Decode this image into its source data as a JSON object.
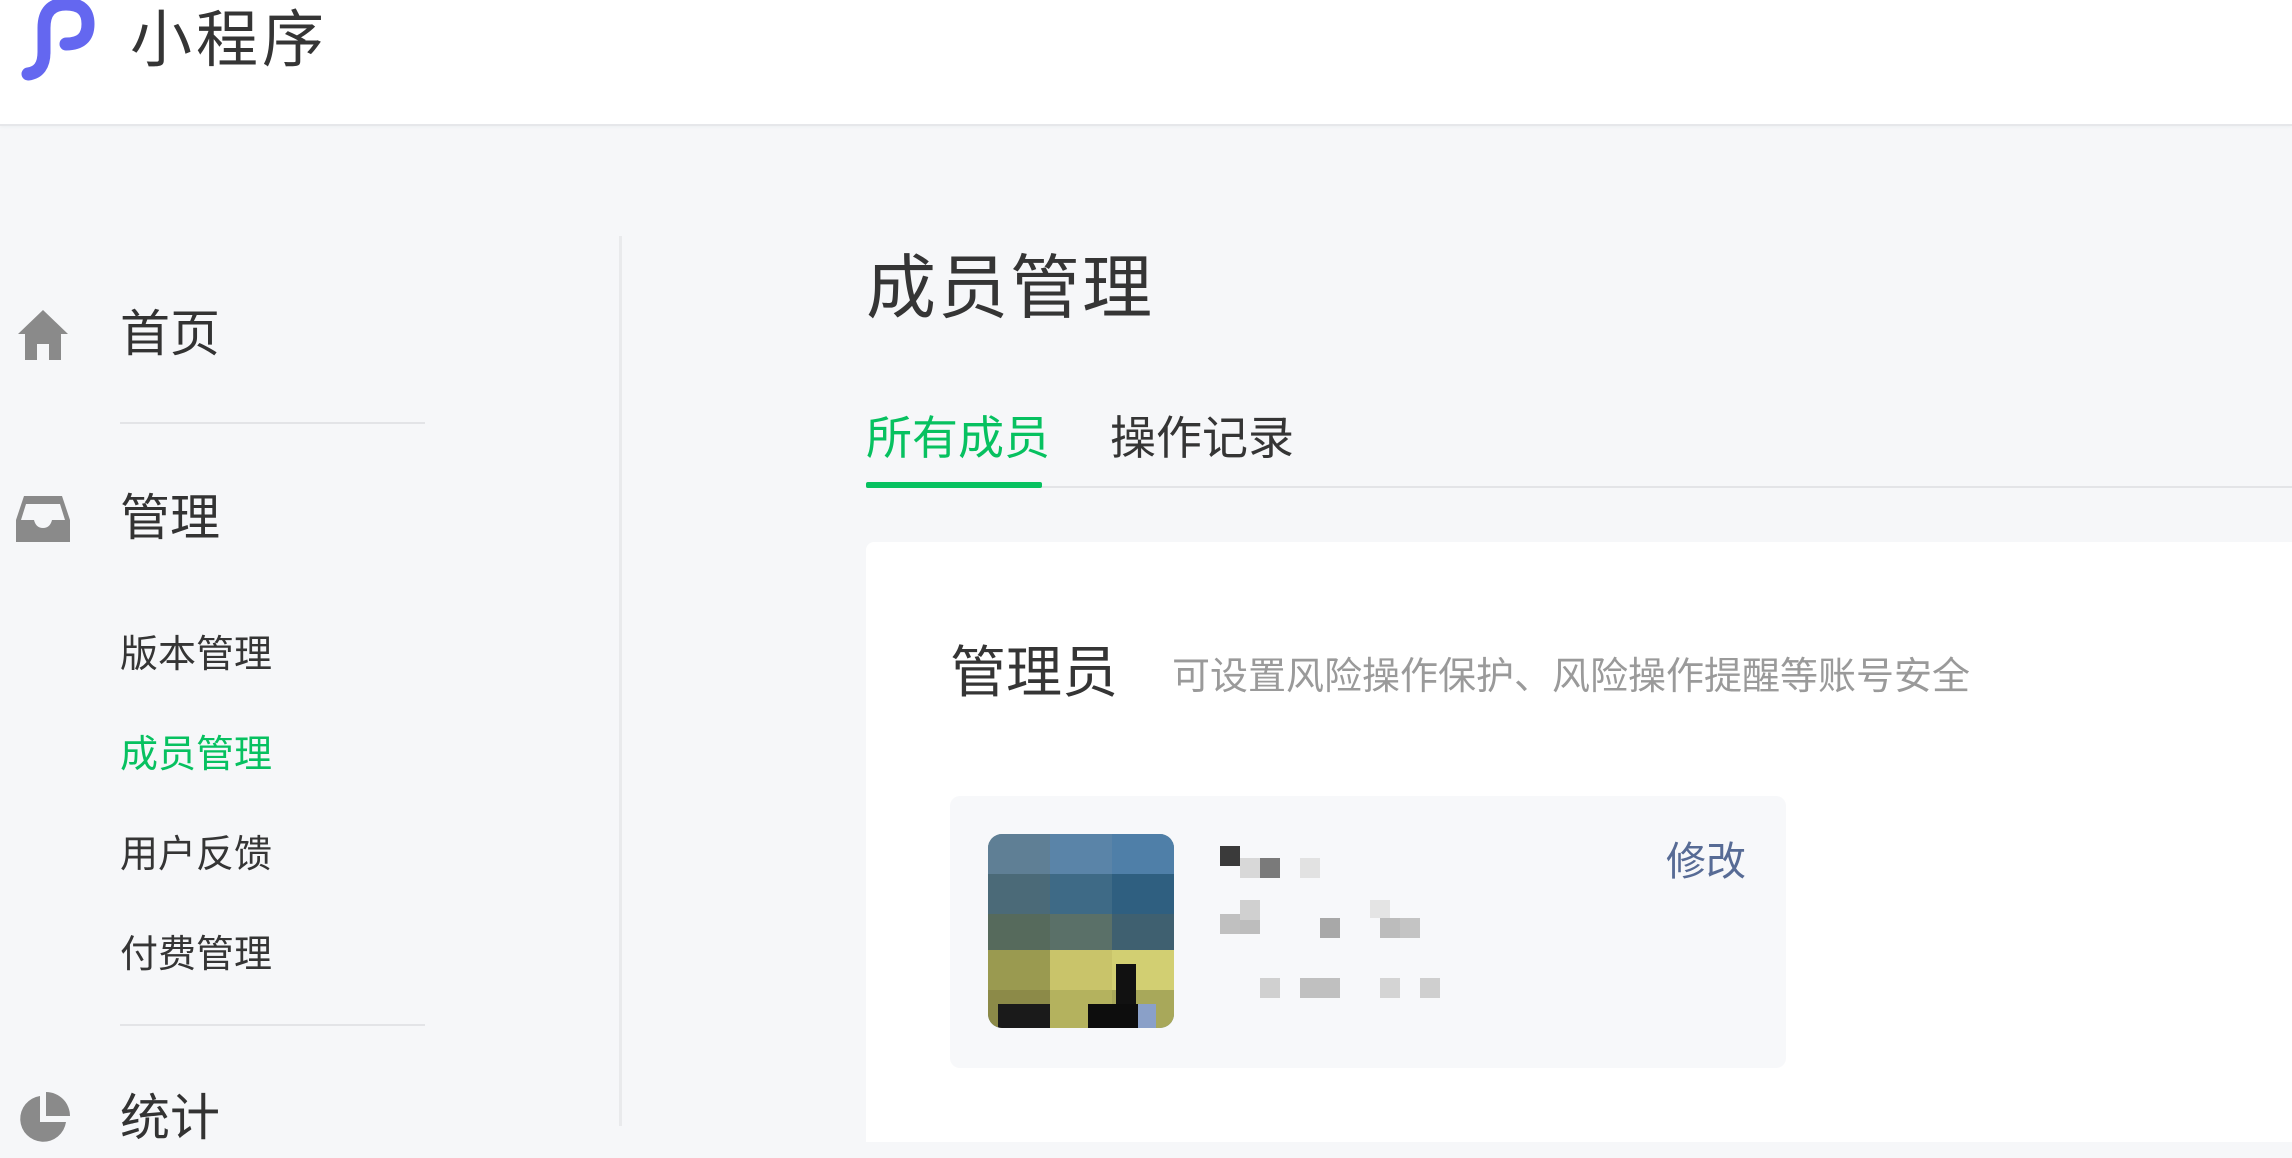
{
  "header": {
    "app_title": "小程序",
    "logo_icon": "mini-program-logo-icon",
    "logo_color": "#6467f0"
  },
  "sidebar": {
    "groups": [
      {
        "label": "首页",
        "icon": "home-icon"
      },
      {
        "label": "管理",
        "icon": "inbox-icon",
        "items": [
          {
            "label": "版本管理",
            "active": false
          },
          {
            "label": "成员管理",
            "active": true
          },
          {
            "label": "用户反馈",
            "active": false
          },
          {
            "label": "付费管理",
            "active": false
          }
        ]
      },
      {
        "label": "统计",
        "icon": "pie-chart-icon"
      }
    ]
  },
  "main": {
    "page_title": "成员管理",
    "tabs": [
      {
        "label": "所有成员",
        "active": true
      },
      {
        "label": "操作记录",
        "active": false
      }
    ],
    "admin_section": {
      "title": "管理员",
      "description": "可设置风险操作保护、风险操作提醒等账号安全",
      "member": {
        "edit_label": "修改"
      }
    }
  },
  "colors": {
    "accent": "#07c160",
    "link": "#576b95",
    "muted_text": "#9a9a9a",
    "icon_gray": "#8a8a8a"
  }
}
